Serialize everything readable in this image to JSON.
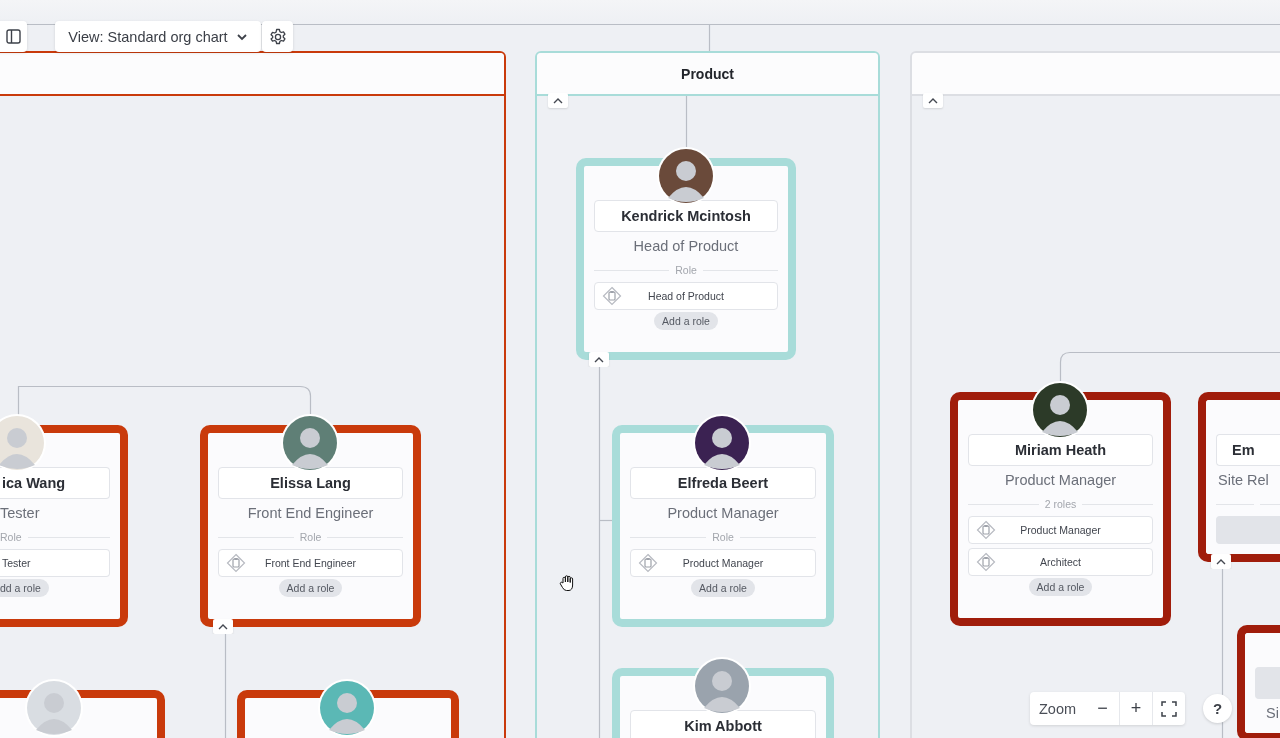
{
  "toolbar": {
    "view_selector": "View: Standard org chart"
  },
  "groups": [
    {
      "color": "#c93a0b",
      "frame_highlighted": true,
      "people": [
        {
          "avatar": true,
          "name": "ica Wang",
          "title": "Tester",
          "role_label": "Role",
          "roles": [
            "Tester"
          ],
          "add_role": "dd a role"
        },
        {
          "avatar": true,
          "name": "Elissa Lang",
          "title": "Front End Engineer",
          "role_label": "Role",
          "roles": [
            "Front End Engineer"
          ],
          "add_role": "Add a role",
          "expanded": true
        },
        {
          "avatar": true
        },
        {
          "avatar": true
        }
      ]
    },
    {
      "title": "Product",
      "color": "#a8dcd9",
      "frame_highlighted": true,
      "expanded": true,
      "people": [
        {
          "avatar": true,
          "name": "Kendrick Mcintosh",
          "title": "Head of Product",
          "role_label": "Role",
          "roles": [
            "Head of Product"
          ],
          "add_role": "Add a role",
          "expanded": true
        },
        {
          "avatar": true,
          "name": "Elfreda Beert",
          "title": "Product Manager",
          "role_label": "Role",
          "roles": [
            "Product Manager"
          ],
          "add_role": "Add a role"
        },
        {
          "avatar": true,
          "name": "Kim Abbott"
        }
      ]
    },
    {
      "color": "#a01d0b",
      "frame_highlighted": false,
      "expanded": true,
      "people": [
        {
          "avatar": true,
          "name": "Miriam Heath",
          "title": "Product Manager",
          "role_label": "2 roles",
          "roles": [
            "Product Manager",
            "Architect"
          ],
          "add_role": "Add a role"
        },
        {
          "avatar": false,
          "name": "Em",
          "title": "Site Rel",
          "loading": true,
          "expanded": true
        },
        {
          "avatar": false,
          "title": "Si",
          "loading": true
        }
      ]
    }
  ],
  "zoom": {
    "label": "Zoom",
    "minus": "−",
    "plus": "+"
  },
  "help": {
    "label": "?"
  }
}
